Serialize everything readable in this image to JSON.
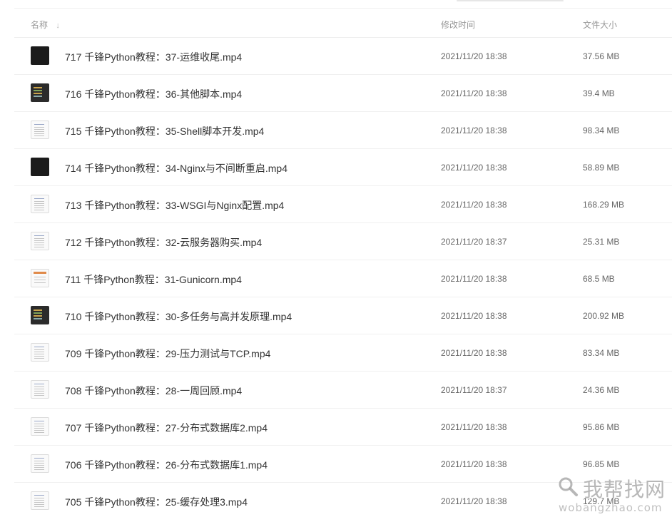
{
  "header": {
    "name_label": "名称",
    "sort_icon": "arrow-down-icon",
    "time_label": "修改时间",
    "size_label": "文件大小"
  },
  "files": [
    {
      "thumb": "dark",
      "name": "717 千锋Python教程：37-运维收尾.mp4",
      "time": "2021/11/20 18:38",
      "size": "37.56 MB"
    },
    {
      "thumb": "darkcode",
      "name": "716 千锋Python教程：36-其他脚本.mp4",
      "time": "2021/11/20 18:38",
      "size": "39.4 MB"
    },
    {
      "thumb": "doc",
      "name": "715 千锋Python教程：35-Shell脚本开发.mp4",
      "time": "2021/11/20 18:38",
      "size": "98.34 MB"
    },
    {
      "thumb": "dark",
      "name": "714 千锋Python教程：34-Nginx与不间断重启.mp4",
      "time": "2021/11/20 18:38",
      "size": "58.89 MB"
    },
    {
      "thumb": "doc",
      "name": "713 千锋Python教程：33-WSGI与Nginx配置.mp4",
      "time": "2021/11/20 18:38",
      "size": "168.29 MB"
    },
    {
      "thumb": "doc",
      "name": "712 千锋Python教程：32-云服务器购买.mp4",
      "time": "2021/11/20 18:37",
      "size": "25.31 MB"
    },
    {
      "thumb": "docorange",
      "name": "711 千锋Python教程：31-Gunicorn.mp4",
      "time": "2021/11/20 18:38",
      "size": "68.5 MB"
    },
    {
      "thumb": "darkcode",
      "name": "710 千锋Python教程：30-多任务与高并发原理.mp4",
      "time": "2021/11/20 18:38",
      "size": "200.92 MB"
    },
    {
      "thumb": "doc",
      "name": "709 千锋Python教程：29-压力测试与TCP.mp4",
      "time": "2021/11/20 18:38",
      "size": "83.34 MB"
    },
    {
      "thumb": "doc",
      "name": "708 千锋Python教程：28-一周回顾.mp4",
      "time": "2021/11/20 18:37",
      "size": "24.36 MB"
    },
    {
      "thumb": "doc",
      "name": "707 千锋Python教程：27-分布式数据库2.mp4",
      "time": "2021/11/20 18:38",
      "size": "95.86 MB"
    },
    {
      "thumb": "doc",
      "name": "706 千锋Python教程：26-分布式数据库1.mp4",
      "time": "2021/11/20 18:38",
      "size": "96.85 MB"
    },
    {
      "thumb": "doc",
      "name": "705 千锋Python教程：25-缓存处理3.mp4",
      "time": "2021/11/20 18:38",
      "size": "129.7 MB"
    }
  ],
  "watermark": {
    "title": "我帮找网",
    "url": "wobangzhao.com",
    "icon": "magnifier-icon"
  }
}
